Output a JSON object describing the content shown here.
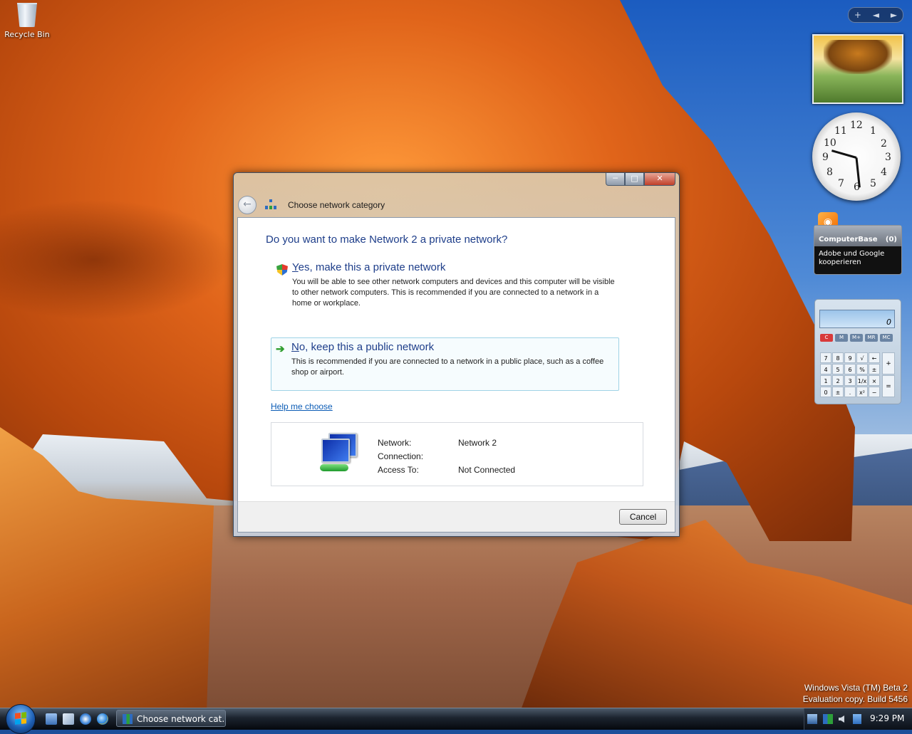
{
  "desktop": {
    "icons": [
      {
        "label": "Recycle Bin",
        "icon": "recycle-bin-icon"
      }
    ]
  },
  "sidebar": {
    "controls": [
      "+",
      "◄",
      "►"
    ],
    "clock": {
      "numerals": [
        "12",
        "1",
        "2",
        "3",
        "4",
        "5",
        "6",
        "7",
        "8",
        "9",
        "10",
        "11"
      ]
    },
    "feed": {
      "title": "ComputerBase",
      "count": "(0)",
      "headline": "Adobe und Google kooperieren"
    },
    "calculator": {
      "display": "0",
      "memory_keys": [
        "C",
        "M",
        "M+",
        "MR",
        "MC"
      ],
      "keys": [
        "7",
        "8",
        "9",
        "√",
        "←",
        "4",
        "5",
        "6",
        "%",
        "±",
        "1",
        "2",
        "3",
        "1/x",
        "×",
        "0",
        "±",
        ".",
        "x²",
        "−"
      ],
      "ops": [
        "+",
        "="
      ]
    }
  },
  "window": {
    "nav_title": "Choose network category",
    "controls": {
      "minimize": "─",
      "maximize": "□",
      "close": "✕"
    },
    "heading": "Do you want to make Network 2 a private network?",
    "options": [
      {
        "icon": "shield-icon",
        "title_accel": "Y",
        "title_rest": "es, make this a private network",
        "description": "You will be able to see other network computers and devices and this computer will be visible to other network computers. This is recommended if you are connected to a network in a home or workplace."
      },
      {
        "icon": "green-arrow-icon",
        "title_accel": "N",
        "title_rest": "o, keep this a public network",
        "description": "This is recommended if you are connected to a network in a public place, such as a coffee shop or airport."
      }
    ],
    "help_link": "Help me choose",
    "info": {
      "labels": [
        "Network:",
        "Connection:",
        "Access To:"
      ],
      "values": [
        "Network 2",
        "",
        "Not Connected"
      ]
    },
    "cancel_label": "Cancel"
  },
  "taskbar": {
    "task_button": "Choose network cat...",
    "clock": "9:29 PM"
  },
  "watermark": {
    "line1": "Windows Vista (TM) Beta 2",
    "line2": "Evaluation copy. Build 5456"
  },
  "colors": {
    "accent": "#1e3e8a",
    "link": "#0a5bb5",
    "selection_border": "#9fd3e6"
  }
}
